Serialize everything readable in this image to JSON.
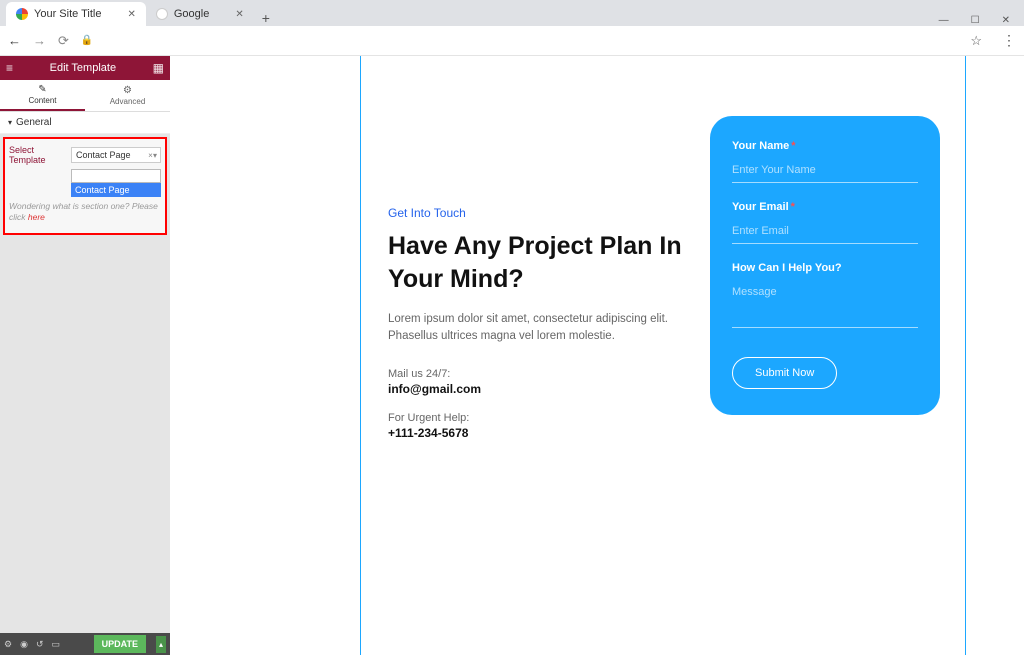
{
  "browser": {
    "tabs": [
      {
        "title": "Your Site Title"
      },
      {
        "title": "Google"
      }
    ],
    "window_buttons": {
      "min": "—",
      "max": "☐",
      "close": "✕"
    }
  },
  "sidebar": {
    "header": "Edit Template",
    "tabs": {
      "content": "Content",
      "advanced": "Advanced"
    },
    "section": "General",
    "select_label": "Select Template",
    "select_value": "Contact Page",
    "dropdown_option": "Contact Page",
    "help_prefix": "Wondering what is section one? Please click ",
    "help_link": "here",
    "update": "UPDATE"
  },
  "page": {
    "subhead": "Get Into Touch",
    "heading": "Have Any Project Plan In Your Mind?",
    "paragraph": "Lorem ipsum dolor sit amet, consectetur adipiscing elit. Phasellus ultrices magna vel lorem molestie.",
    "mail_label": "Mail us 24/7:",
    "mail_value": "info@gmail.com",
    "phone_label": "For Urgent Help:",
    "phone_value": "+111-234-5678"
  },
  "form": {
    "name_label": "Your Name",
    "name_placeholder": "Enter Your Name",
    "email_label": "Your Email",
    "email_placeholder": "Enter Email",
    "help_label": "How Can I Help You?",
    "help_placeholder": "Message",
    "submit": "Submit Now"
  }
}
